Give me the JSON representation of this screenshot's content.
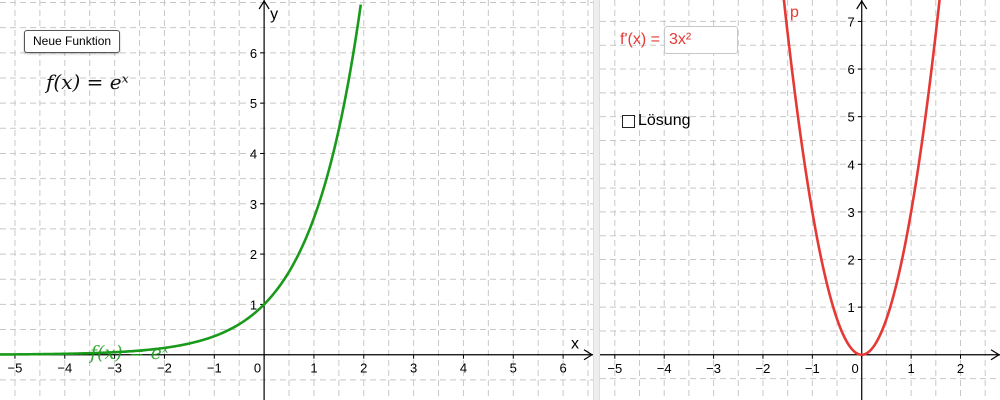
{
  "left_panel": {
    "button_label": "Neue Funktion",
    "function_formula": "f(x) = eˣ",
    "curve_label": "f(x) = eˣ",
    "axis_x_name": "x",
    "axis_y_name": "y",
    "curve_color": "#1a9a1a",
    "x_ticks": [
      "−5",
      "−4",
      "−3",
      "−2",
      "−1",
      "0",
      "1",
      "2",
      "3",
      "4",
      "5",
      "6"
    ],
    "y_ticks": [
      "1",
      "2",
      "3",
      "4",
      "5",
      "6"
    ]
  },
  "right_panel": {
    "derivative_label": "f'(x) =",
    "derivative_value": "3x²",
    "solution_label": "Lösung",
    "solution_checked": false,
    "parabola_label": "p",
    "curve_color": "#e53935",
    "x_ticks": [
      "−5",
      "−4",
      "−3",
      "−2",
      "−1",
      "0",
      "1",
      "2"
    ],
    "y_ticks": [
      "1",
      "2",
      "3",
      "4",
      "5",
      "6",
      "7"
    ]
  },
  "chart_data": [
    {
      "type": "line",
      "function": "exp(x)",
      "xlim": [
        -5.3,
        6.6
      ],
      "ylim": [
        -0.9,
        7.05
      ],
      "x": [
        -5.3,
        -4,
        -3,
        -2,
        -1,
        0,
        0.5,
        1,
        1.5,
        1.94
      ],
      "y": [
        0.005,
        0.018,
        0.05,
        0.135,
        0.368,
        1,
        1.649,
        2.718,
        4.482,
        6.96
      ],
      "grid": true,
      "xlabel": "x",
      "ylabel": "y"
    },
    {
      "type": "line",
      "function": "3*x^2",
      "xlim": [
        -5.3,
        2.8
      ],
      "ylim": [
        -0.95,
        7.45
      ],
      "x": [
        -1.58,
        -1.2,
        -0.8,
        -0.4,
        0,
        0.4,
        0.8,
        1.2,
        1.58
      ],
      "y": [
        7.49,
        4.32,
        1.92,
        0.48,
        0,
        0.48,
        1.92,
        4.32,
        7.49
      ],
      "grid": true
    }
  ]
}
